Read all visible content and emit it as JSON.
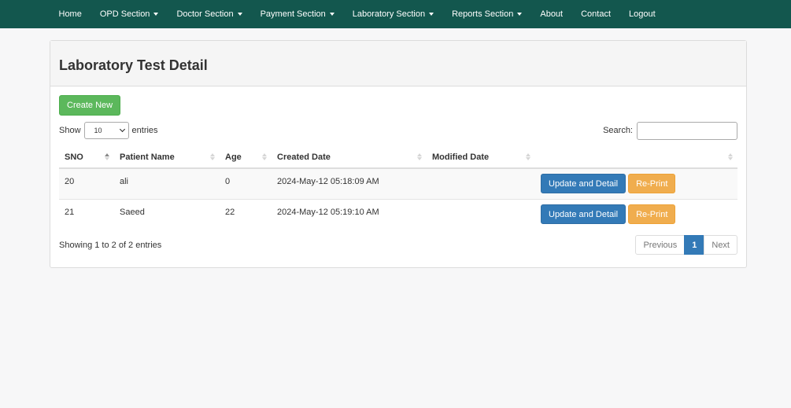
{
  "nav": {
    "home": "Home",
    "opd": "OPD Section",
    "doctor": "Doctor Section",
    "payment": "Payment Section",
    "laboratory": "Laboratory Section",
    "reports": "Reports Section",
    "about": "About",
    "contact": "Contact",
    "logout": "Logout"
  },
  "page": {
    "title": "Laboratory Test Detail",
    "create_label": "Create New"
  },
  "length": {
    "show_label": "Show",
    "value": "10",
    "entries_label": "entries"
  },
  "search": {
    "label": "Search:",
    "value": ""
  },
  "table": {
    "headers": [
      "SNO",
      "Patient Name",
      "Age",
      "Created Date",
      "Modified Date",
      ""
    ],
    "rows": [
      {
        "sno": "20",
        "name": "ali",
        "age": "0",
        "created": "2024-May-12 05:18:09 AM",
        "modified": "",
        "update_label": "Update and Detail",
        "reprint_label": "Re-Print"
      },
      {
        "sno": "21",
        "name": "Saeed",
        "age": "22",
        "created": "2024-May-12 05:19:10 AM",
        "modified": "",
        "update_label": "Update and Detail",
        "reprint_label": "Re-Print"
      }
    ]
  },
  "footer": {
    "info": "Showing 1 to 2 of 2 entries",
    "prev": "Previous",
    "page": "1",
    "next": "Next"
  },
  "colors": {
    "navbar": "#13574e",
    "success": "#5cb85c",
    "primary": "#337ab7",
    "warning": "#f0ad4e"
  }
}
